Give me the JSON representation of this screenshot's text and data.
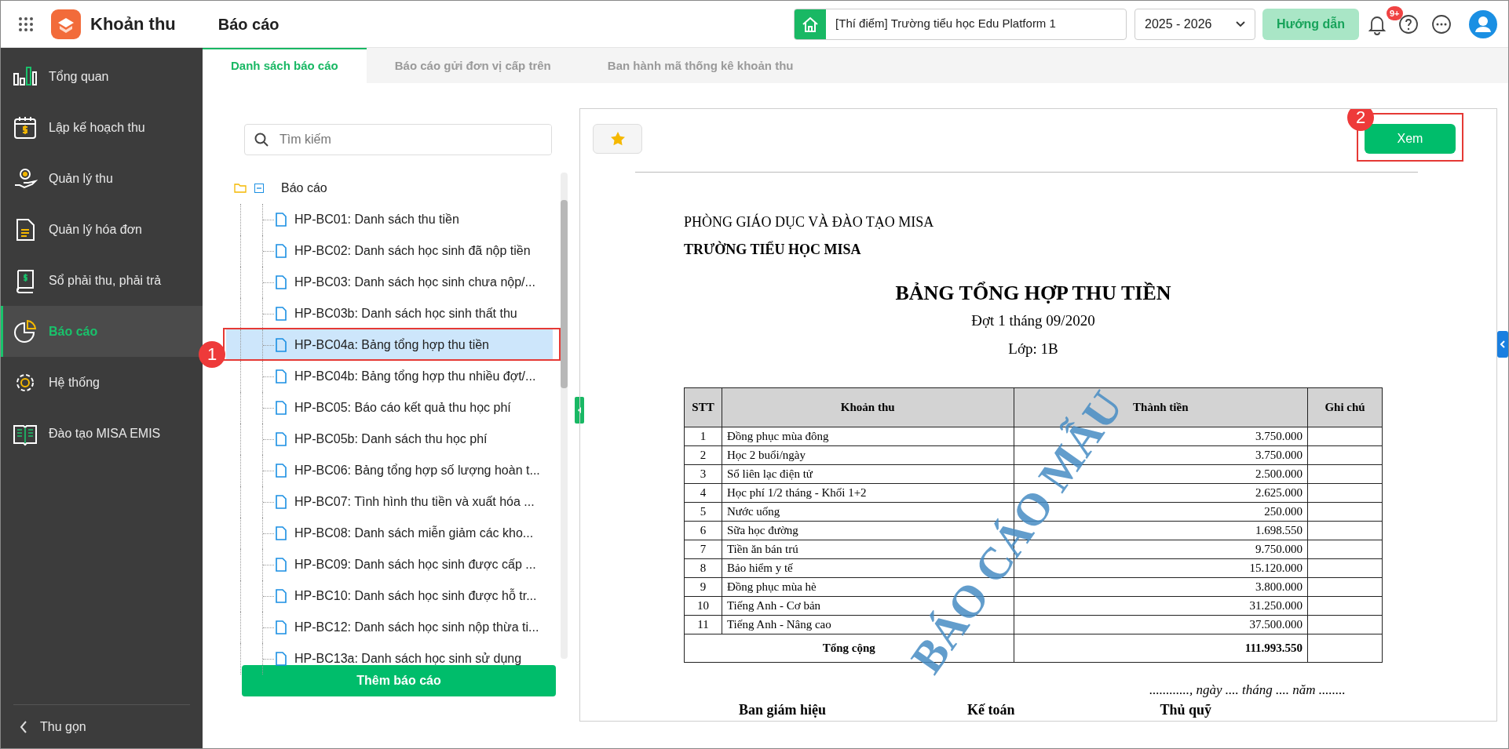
{
  "app": {
    "title": "Khoản thu"
  },
  "header": {
    "page_title": "Báo cáo",
    "school": "[Thí điểm] Trường tiểu học Edu Platform 1",
    "year": "2025 - 2026",
    "guide_button": "Hướng dẫn",
    "notification_badge": "9+"
  },
  "sidebar": {
    "items": [
      {
        "label": "Tổng quan",
        "kind": "chart",
        "selected": false
      },
      {
        "label": "Lập kế hoạch thu",
        "kind": "calendar",
        "selected": false
      },
      {
        "label": "Quản lý thu",
        "kind": "coin",
        "selected": false
      },
      {
        "label": "Quản lý hóa đơn",
        "kind": "invoice",
        "selected": false
      },
      {
        "label": "Sổ phải thu, phải trả",
        "kind": "ledger",
        "selected": false
      },
      {
        "label": "Báo cáo",
        "kind": "pie",
        "selected": true
      },
      {
        "label": "Hệ thống",
        "kind": "gear",
        "selected": false
      },
      {
        "label": "Đào tạo MISA EMIS",
        "kind": "book",
        "selected": false
      }
    ],
    "collapse": "Thu gọn"
  },
  "tabs": [
    {
      "label": "Danh sách báo cáo",
      "selected": true
    },
    {
      "label": "Báo cáo gửi đơn vị cấp trên",
      "selected": false
    },
    {
      "label": "Ban hành mã thống kê khoản thu",
      "selected": false
    }
  ],
  "search": {
    "placeholder": "Tìm kiếm"
  },
  "tree": {
    "label": "Báo cáo",
    "expanded": true,
    "children": [
      {
        "label": "HP-BC01: Danh sách thu tiền",
        "selected": false
      },
      {
        "label": "HP-BC02: Danh sách học sinh đã nộp tiền",
        "selected": false
      },
      {
        "label": "HP-BC03: Danh sách học sinh chưa nộp/...",
        "selected": false
      },
      {
        "label": "HP-BC03b: Danh sách học sinh thất thu",
        "selected": false
      },
      {
        "label": "HP-BC04a: Bảng tổng hợp thu tiền",
        "selected": true
      },
      {
        "label": "HP-BC04b: Bảng tổng hợp thu nhiều đợt/...",
        "selected": false
      },
      {
        "label": "HP-BC05: Báo cáo kết quả thu học phí",
        "selected": false
      },
      {
        "label": "HP-BC05b: Danh sách thu học phí",
        "selected": false
      },
      {
        "label": "HP-BC06: Bảng tổng hợp số lượng hoàn t...",
        "selected": false
      },
      {
        "label": "HP-BC07: Tình hình thu tiền và xuất hóa ...",
        "selected": false
      },
      {
        "label": "HP-BC08: Danh sách miễn giảm các kho...",
        "selected": false
      },
      {
        "label": "HP-BC09: Danh sách học sinh được cấp ...",
        "selected": false
      },
      {
        "label": "HP-BC10: Danh sách học sinh được hỗ tr...",
        "selected": false
      },
      {
        "label": "HP-BC12: Danh sách học sinh nộp thừa ti...",
        "selected": false
      },
      {
        "label": "HP-BC13a: Danh sách học sinh sử dụng",
        "selected": false
      }
    ]
  },
  "add_button": "Thêm báo cáo",
  "view_button": "Xem",
  "report": {
    "department": "PHÒNG GIÁO DỤC VÀ ĐÀO TẠO MISA",
    "school": "TRƯỜNG TIỂU HỌC MISA",
    "title": "BẢNG TỔNG HỢP THU TIỀN",
    "period": "Đợt 1 tháng 09/2020",
    "class": "Lớp: 1B",
    "columns": [
      "STT",
      "Khoản thu",
      "Thành tiền",
      "Ghi chú"
    ],
    "rows": [
      [
        "1",
        "Đồng phục mùa đông",
        "3.750.000"
      ],
      [
        "2",
        "Học 2 buổi/ngày",
        "3.750.000"
      ],
      [
        "3",
        "Sổ liên lạc điện tử",
        "2.500.000"
      ],
      [
        "4",
        "Học phí 1/2 tháng - Khối 1+2",
        "2.625.000"
      ],
      [
        "5",
        "Nước uống",
        "250.000"
      ],
      [
        "6",
        "Sữa học đường",
        "1.698.550"
      ],
      [
        "7",
        "Tiền ăn bán trú",
        "9.750.000"
      ],
      [
        "8",
        "Bảo hiểm y tế",
        "15.120.000"
      ],
      [
        "9",
        "Đồng phục mùa hè",
        "3.800.000"
      ],
      [
        "10",
        "Tiếng Anh - Cơ bản",
        "31.250.000"
      ],
      [
        "11",
        "Tiếng Anh - Nâng cao",
        "37.500.000"
      ]
    ],
    "total_label": "Tổng cộng",
    "total": "111.993.550",
    "date_line": "............, ngày .... tháng .... năm ........",
    "signatures": [
      "Ban giám hiệu",
      "Kế toán",
      "Thủ quỹ"
    ],
    "stamp": "BÁO CÁO MẪU"
  },
  "callouts": [
    {
      "number": "1"
    },
    {
      "number": "2"
    }
  ]
}
